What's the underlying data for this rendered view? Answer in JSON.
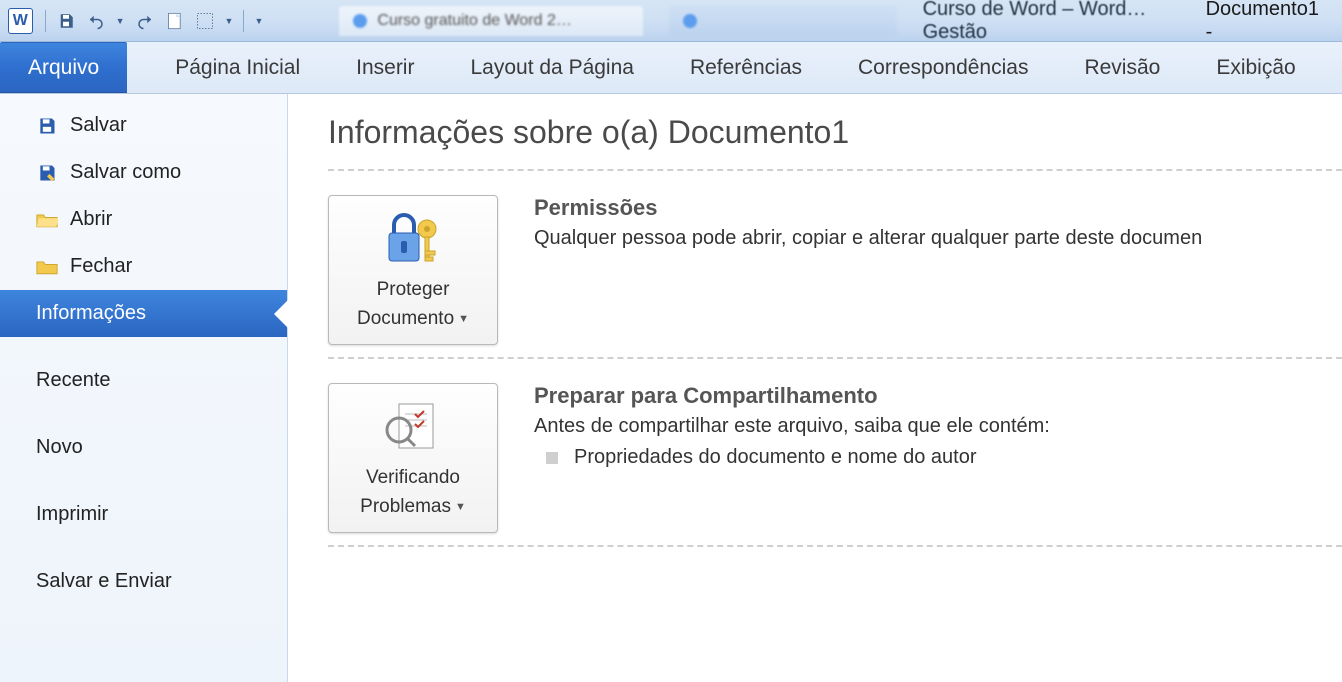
{
  "titlebar": {
    "app_letter": "W",
    "document_name": "Documento1 -",
    "browser_hint_a": "Curso gratuito de Word 2…",
    "browser_hint_b": "Curso de Word  – Word…  Gestão"
  },
  "ribbon": {
    "tabs": [
      {
        "label": "Arquivo",
        "active": true
      },
      {
        "label": "Página Inicial"
      },
      {
        "label": "Inserir"
      },
      {
        "label": "Layout da Página"
      },
      {
        "label": "Referências"
      },
      {
        "label": "Correspondências"
      },
      {
        "label": "Revisão"
      },
      {
        "label": "Exibição"
      }
    ]
  },
  "sidebar": {
    "items": [
      {
        "key": "salvar",
        "label": "Salvar",
        "icon": "save"
      },
      {
        "key": "salvarcomo",
        "label": "Salvar como",
        "icon": "save-as"
      },
      {
        "key": "abrir",
        "label": "Abrir",
        "icon": "folder-open"
      },
      {
        "key": "fechar",
        "label": "Fechar",
        "icon": "folder-close"
      },
      {
        "key": "info",
        "label": "Informações",
        "selected": true
      },
      {
        "key": "recente",
        "label": "Recente"
      },
      {
        "key": "novo",
        "label": "Novo"
      },
      {
        "key": "imprimir",
        "label": "Imprimir"
      },
      {
        "key": "salvarenviar",
        "label": "Salvar e Enviar"
      }
    ]
  },
  "main": {
    "title": "Informações sobre o(a) Documento1",
    "protect": {
      "button_line1": "Proteger",
      "button_line2": "Documento",
      "heading": "Permissões",
      "body": "Qualquer pessoa pode abrir, copiar e alterar qualquer parte deste documen"
    },
    "share": {
      "button_line1": "Verificando",
      "button_line2": "Problemas",
      "heading": "Preparar para Compartilhamento",
      "body": "Antes de compartilhar este arquivo, saiba que ele contém:",
      "bullets": [
        "Propriedades do documento e nome do autor"
      ]
    }
  }
}
